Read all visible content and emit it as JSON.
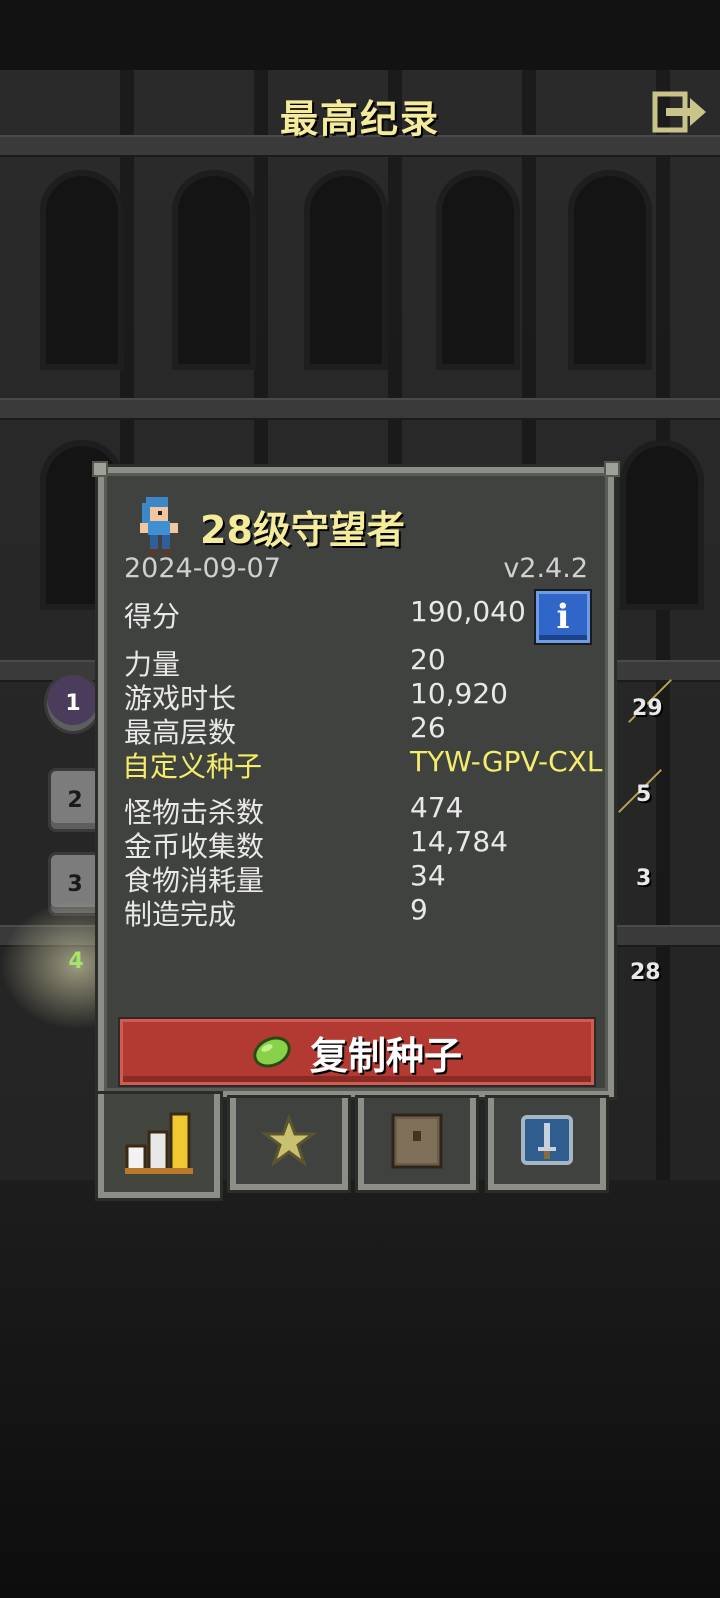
{
  "screen": {
    "title": "最高纪录"
  },
  "side_ranks": [
    "1",
    "2",
    "3",
    "4"
  ],
  "side_right_numbers": [
    "29",
    "5",
    "3",
    "28"
  ],
  "record": {
    "hero_title": "28级守望者",
    "date": "2024-09-07",
    "version": "v2.4.2",
    "score_label": "得分",
    "score_value": "190,040",
    "info_icon_text": "i",
    "stats_group1": [
      {
        "label": "力量",
        "value": "20"
      },
      {
        "label": "游戏时长",
        "value": "10,920"
      },
      {
        "label": "最高层数",
        "value": "26"
      }
    ],
    "custom_seed": {
      "label": "自定义种子",
      "value": "TYW-GPV-CXL"
    },
    "stats_group2": [
      {
        "label": "怪物击杀数",
        "value": "474"
      },
      {
        "label": "金币收集数",
        "value": "14,784"
      },
      {
        "label": "食物消耗量",
        "value": "34"
      },
      {
        "label": "制造完成",
        "value": "9"
      }
    ],
    "copy_seed_button": "复制种子"
  },
  "tabs": [
    {
      "icon": "stats-bars-icon",
      "active": true
    },
    {
      "icon": "star-icon",
      "active": false
    },
    {
      "icon": "journal-icon",
      "active": false
    },
    {
      "icon": "sword-badge-icon",
      "active": false
    }
  ],
  "colors": {
    "title_yellow": "#f4ec9a",
    "highlight_yellow": "#f4ec6a",
    "button_red": "#b33a32",
    "info_blue": "#2f66c8",
    "panel_bg": "#3f423e"
  }
}
